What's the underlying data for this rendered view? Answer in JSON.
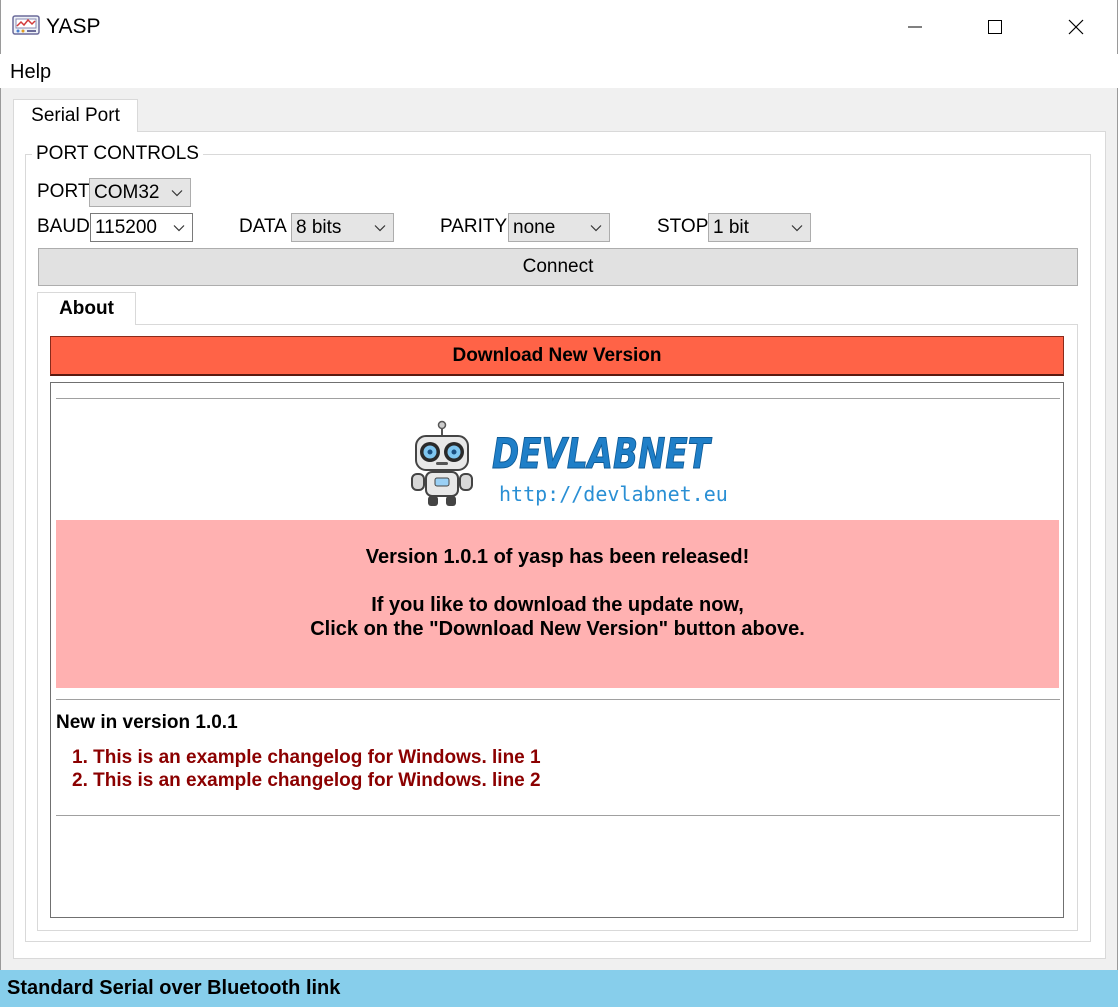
{
  "window": {
    "title": "YASP",
    "icon": "yasp-app-icon",
    "controls": [
      "minimize-icon",
      "maximize-icon",
      "close-icon"
    ]
  },
  "menubar": {
    "help": "Help"
  },
  "tabs": {
    "serial_port": "Serial Port"
  },
  "port_controls": {
    "title": "PORT CONTROLS",
    "port_label": "PORT",
    "port_value": "COM32",
    "baud_label": "BAUD",
    "baud_value": "115200",
    "data_label": "DATA",
    "data_value": "8 bits",
    "parity_label": "PARITY",
    "parity_value": "none",
    "stop_label": "STOP",
    "stop_value": "1 bit",
    "connect_label": "Connect"
  },
  "about": {
    "tab_label": "About",
    "download_label": "Download New Version",
    "logo": {
      "wordmark": "DEVLABNET",
      "url": "http://devlabnet.eu",
      "wordmark_color": "#1f7fc8",
      "url_color": "#2a8fd4"
    },
    "release": {
      "line1": "Version 1.0.1 of yasp has been released!",
      "line2": "If you like to download the update now,",
      "line3": "Click on the \"Download New Version\" button above.",
      "background": "#ffb1b1"
    },
    "changelog": {
      "title": "New in version 1.0.1",
      "items": [
        "1. This is an example changelog for Windows. line 1",
        "2. This is an example changelog for Windows. line 2"
      ],
      "item_color": "#8b0000"
    }
  },
  "statusbar": {
    "text": "Standard Serial over Bluetooth link",
    "background": "#87ceeb"
  },
  "colors": {
    "download_button": "#ff6347"
  }
}
